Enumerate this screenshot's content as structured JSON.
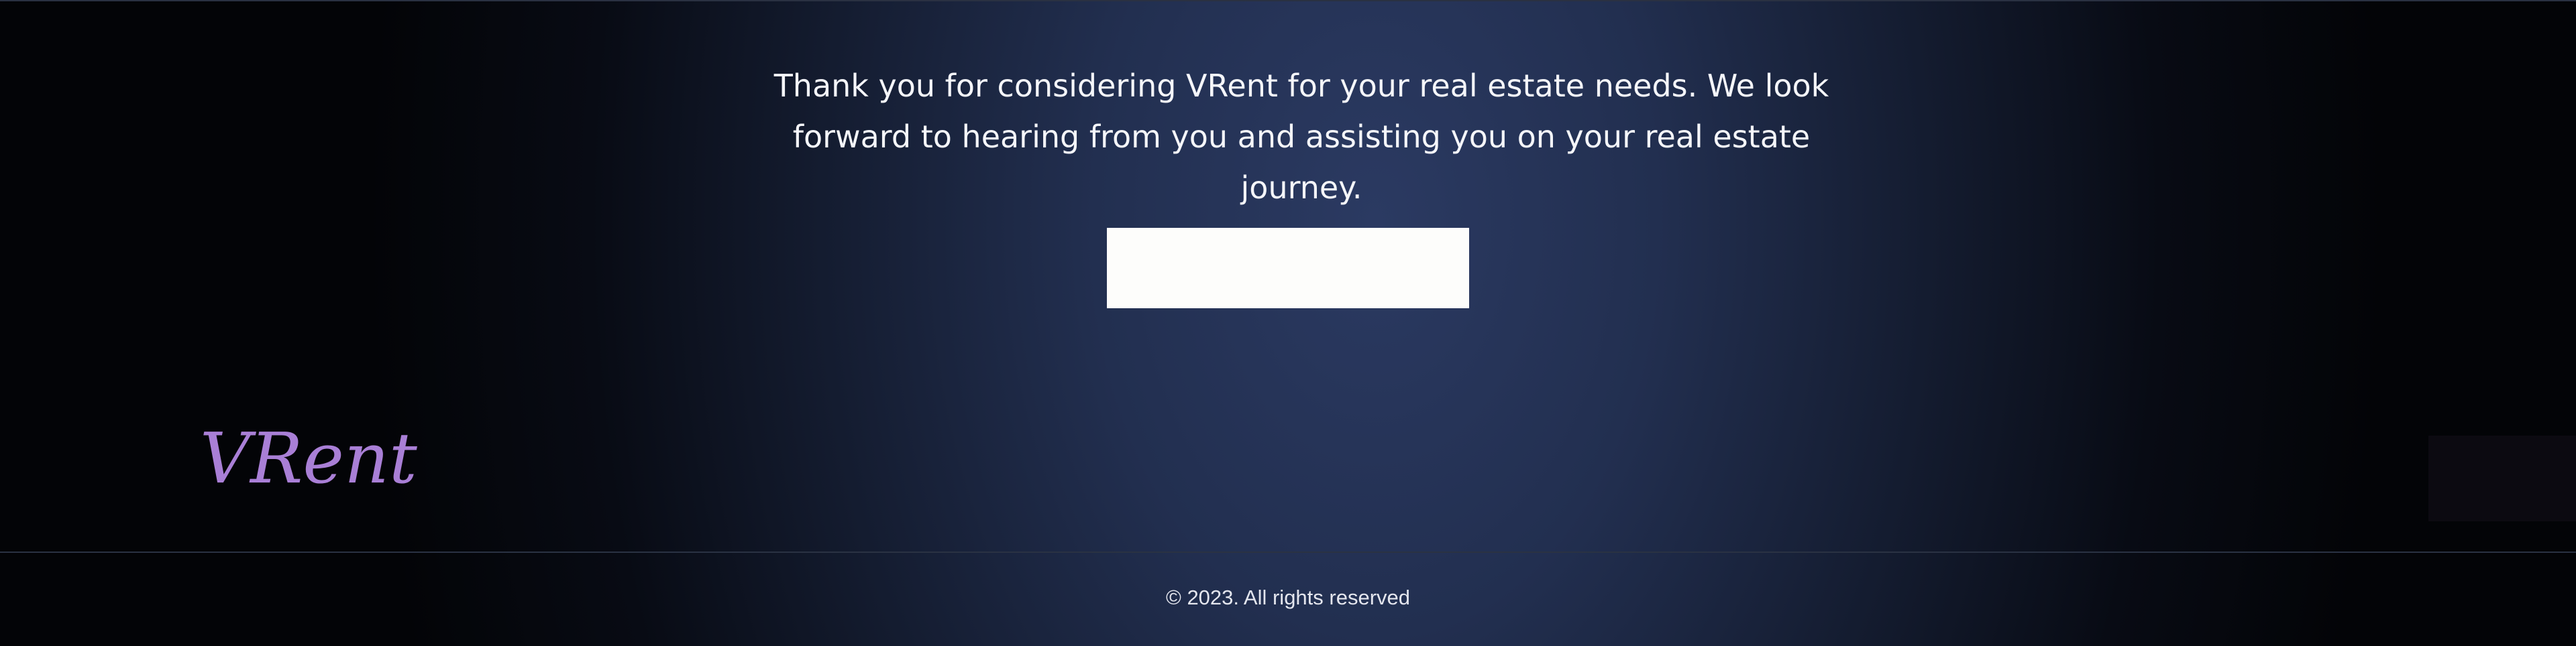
{
  "cta": {
    "message": "Thank you for considering VRent for your real estate needs. We look forward to hearing from you and assisting you on your real estate journey.",
    "button_label": ""
  },
  "brand": {
    "logo_text": "VRent",
    "logo_color": "#a97fd6"
  },
  "footer": {
    "copyright": "© 2023. All rights reserved"
  },
  "colors": {
    "background_center": "#2b3a62",
    "background_edge": "#030407",
    "text": "#f5f6fa",
    "button": "#fdfdfb"
  }
}
